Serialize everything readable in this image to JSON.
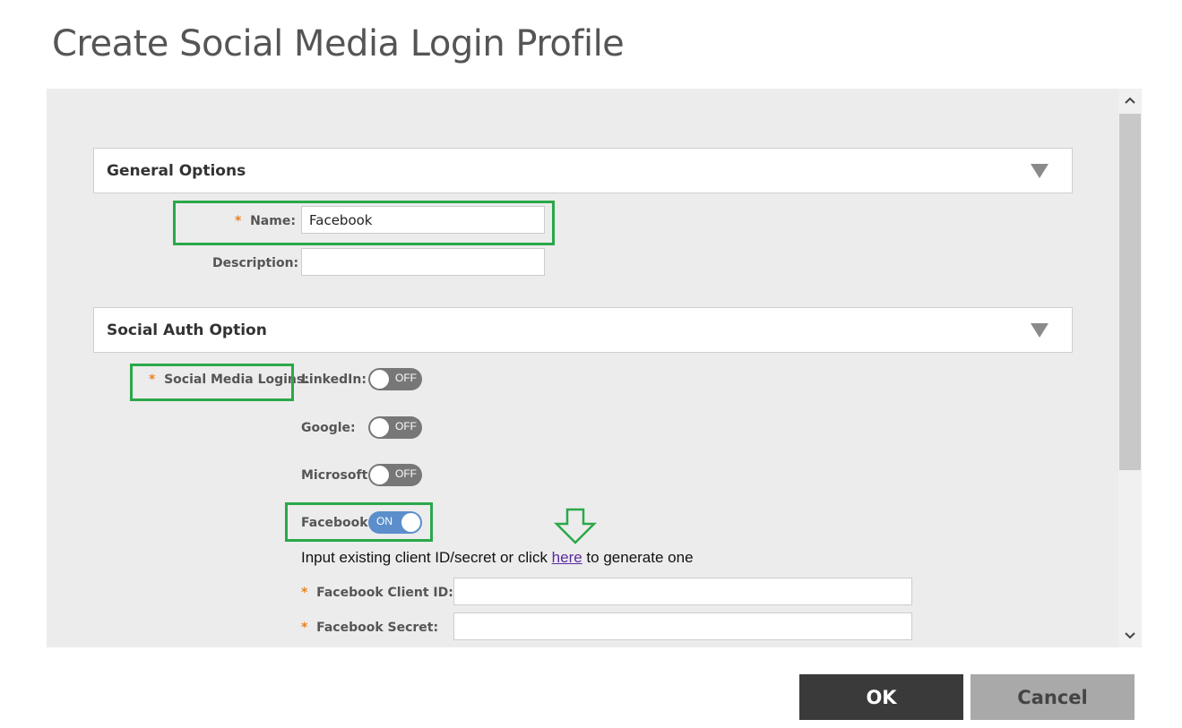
{
  "dialog": {
    "title": "Create Social Media Login Profile"
  },
  "general_options": {
    "header": "General Options",
    "name_label": "Name:",
    "name_value": "Facebook",
    "description_label": "Description:",
    "description_value": ""
  },
  "social_auth": {
    "header": "Social Auth Option",
    "logins_label": "Social Media Logins:",
    "providers": [
      {
        "label": "LinkedIn:",
        "state": "OFF"
      },
      {
        "label": "Google:",
        "state": "OFF"
      },
      {
        "label": "Microsoft:",
        "state": "OFF"
      },
      {
        "label": "Facebook:",
        "state": "ON"
      }
    ],
    "info_prefix": "Input existing client ID/secret or click ",
    "info_link": "here",
    "info_suffix": " to generate one",
    "client_id_label": "Facebook Client ID:",
    "client_id_value": "",
    "secret_label": "Facebook Secret:",
    "secret_value": ""
  },
  "required_marker": "*",
  "buttons": {
    "ok": "OK",
    "cancel": "Cancel"
  },
  "colors": {
    "highlight": "#2aa84a",
    "toggle_on": "#5b8ecb",
    "toggle_off": "#777777",
    "required": "#e8821e"
  }
}
